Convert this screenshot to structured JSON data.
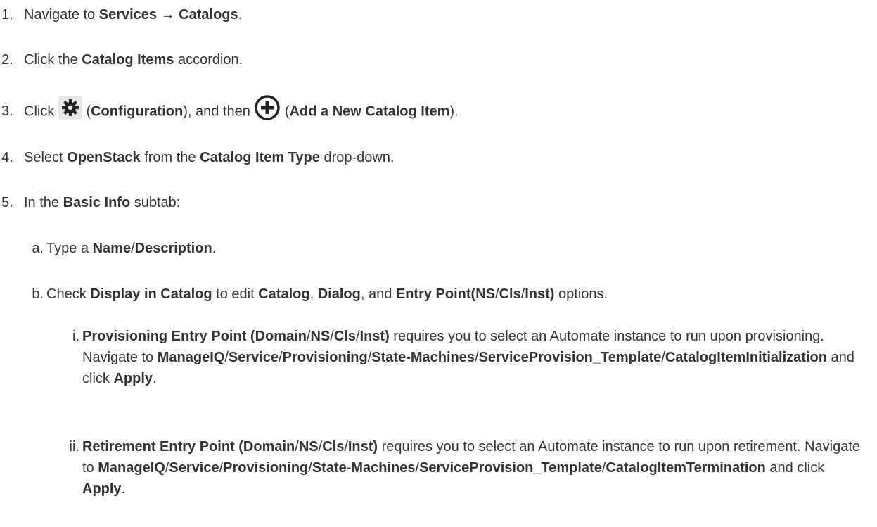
{
  "steps": {
    "s1": {
      "num": "1.",
      "t1": "Navigate to ",
      "b1": "Services",
      "t2": " → ",
      "b2": "Catalogs",
      "t3": "."
    },
    "s2": {
      "num": "2.",
      "t1": "Click the ",
      "b1": "Catalog Items",
      "t2": " accordion."
    },
    "s3": {
      "num": "3.",
      "t1": "Click ",
      "t2": " (",
      "b1": "Configuration",
      "t3": "), and then ",
      "t4": " (",
      "b2": "Add a New Catalog Item",
      "t5": ")."
    },
    "s4": {
      "num": "4.",
      "t1": "Select ",
      "b1": "OpenStack",
      "t2": " from the ",
      "b2": "Catalog Item Type",
      "t3": " drop-down."
    },
    "s5": {
      "num": "5.",
      "t1": "In the ",
      "b1": "Basic Info",
      "t2": " subtab:"
    }
  },
  "substeps": {
    "a": {
      "num": "a.",
      "t1": "Type a ",
      "b1": "Name",
      "t2": "/",
      "b2": "Description",
      "t3": "."
    },
    "b": {
      "num": "b.",
      "t1": "Check ",
      "b1": "Display in Catalog",
      "t2": " to edit ",
      "b2": "Catalog",
      "t3": ", ",
      "b3": "Dialog",
      "t4": ", and ",
      "b4": "Entry Point(NS",
      "t5": "/",
      "b5": "Cls",
      "t6": "/",
      "b6": "Inst)",
      "t7": " options."
    },
    "i": {
      "num": "i.",
      "b1": "Provisioning Entry Point (Domain",
      "t1": "/",
      "b2": "NS",
      "t2": "/",
      "b3": "Cls",
      "t3": "/",
      "b4": "Inst)",
      "t4": " requires you to select an Automate instance to run upon provisioning. Navigate to ",
      "b5": "ManageIQ",
      "t5": "/",
      "b6": "Service",
      "t6": "/",
      "b7": "Provisioning",
      "t7": "/",
      "b8": "State-Machines",
      "t8": "/",
      "b9": "ServiceProvision_Template",
      "t9": "/",
      "b10": "CatalogItemInitialization",
      "t10": " and click ",
      "b11": "Apply",
      "t11": "."
    },
    "ii": {
      "num": "ii.",
      "b1": "Retirement Entry Point (Domain",
      "t1": "/",
      "b2": "NS",
      "t2": "/",
      "b3": "Cls",
      "t3": "/",
      "b4": "Inst)",
      "t4": " requires you to select an Automate instance to run upon retirement. Navigate to ",
      "b5": "ManageIQ",
      "t5": "/",
      "b6": "Service",
      "t6": "/",
      "b7": "Provisioning",
      "t7": "/",
      "b8": "State-Machines",
      "t8": "/",
      "b9": "ServiceProvision_Template",
      "t9": "/",
      "b10": "CatalogItemTermination",
      "t10": " and click ",
      "b11": "Apply",
      "t11": "."
    }
  },
  "icons": {
    "configuration": "gear-icon",
    "add": "add-circle-icon"
  },
  "colors": {
    "text": "#333333",
    "icon_dark": "#222222",
    "gear_bg": "#e8e8e8"
  }
}
